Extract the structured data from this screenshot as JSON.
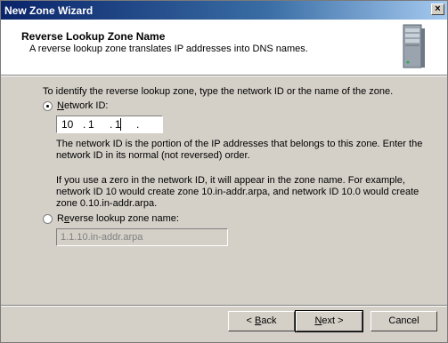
{
  "window": {
    "title": "New Zone Wizard",
    "close_glyph": "×"
  },
  "header": {
    "title": "Reverse Lookup Zone Name",
    "subtitle": "A reverse lookup zone translates IP addresses into DNS names.",
    "icon": "server-icon"
  },
  "content": {
    "intro": "To identify the reverse lookup zone, type the network ID or the name of the zone.",
    "network_id_option": {
      "label_accel": "N",
      "label_rest": "etwork ID:",
      "selected": true
    },
    "network_id_octets": [
      "10",
      "1",
      "1",
      ""
    ],
    "help_text_1": "The network ID is the portion of the IP addresses that belongs to this zone. Enter the network ID in its normal (not reversed) order.",
    "help_text_2": "If you use a zero in the network ID, it will appear in the zone name. For example, network ID 10 would create zone 10.in-addr.arpa, and network ID 10.0 would create zone 0.10.in-addr.arpa.",
    "reverse_zone_option": {
      "label_accel": "e",
      "label_prefix": "R",
      "label_rest": "verse lookup zone name:",
      "selected": false
    },
    "reverse_zone_value": "1.1.10.in-addr.arpa"
  },
  "buttons": {
    "back": {
      "prefix": "< ",
      "accel": "B",
      "rest": "ack"
    },
    "next": {
      "accel": "N",
      "rest": "ext >"
    },
    "cancel": "Cancel"
  }
}
